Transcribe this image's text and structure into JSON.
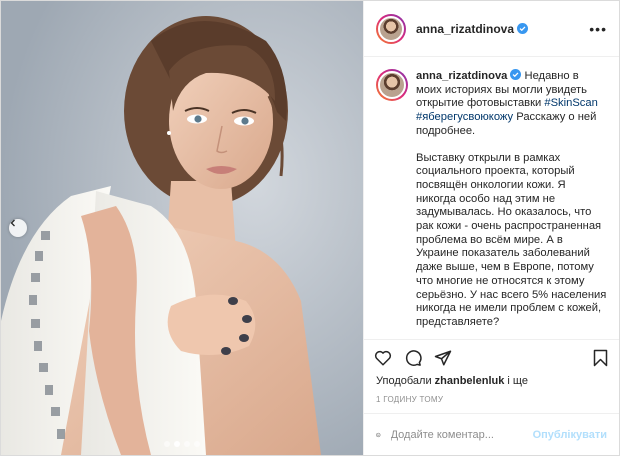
{
  "post": {
    "username": "anna_rizatdinova",
    "caption": {
      "p1_a": "Недавно в моих историях вы могли увидеть открытие фотовыставки ",
      "tag1": "#SkinScan",
      "tag2": "#яберегусвоюкожу",
      "p1_b": " Расскажу о ней подробнее.",
      "p2": "Выставку открыли в рамках социального проекта, который посвящён онкологии кожи. Я никогда особо над этим не задумывалась. Но оказалось, что рак кожи - очень распространенная проблема во всём мире. А в Украине показатель заболеваний даже выше, чем в Европе, потому что многие не относятся к этому серьёзно. У нас всего 5% населения никогда не имели проблем с кожей, представляете?"
    },
    "likes": {
      "prefix": "Уподобали ",
      "user": "zhanbelenluk",
      "suffix": " і ще"
    },
    "time": "1 ГОДИНУ ТОМУ",
    "comment_placeholder": "Додайте коментар...",
    "publish_label": "Опублікувати",
    "carousel": {
      "slides": 4,
      "active": 2
    }
  },
  "icons": [
    "verified-icon",
    "more-icon",
    "heart-icon",
    "comment-icon",
    "share-icon",
    "bookmark-icon",
    "emoji-icon",
    "chevron-left-icon"
  ],
  "colors": {
    "link": "#00376b",
    "verified": "#3897f0",
    "publish": "#b2dffc",
    "muted": "#8e8e8e"
  }
}
